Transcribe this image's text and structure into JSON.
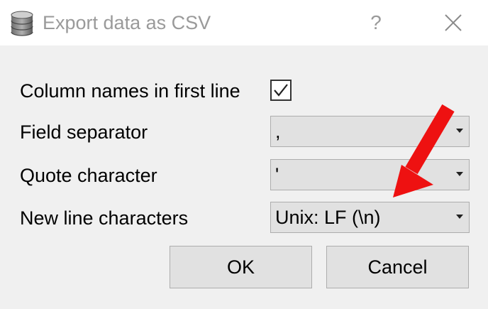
{
  "window": {
    "title": "Export data as CSV",
    "help_label": "?",
    "icon": "database-icon"
  },
  "form": {
    "column_names_label": "Column names in first line",
    "column_names_checked": true,
    "field_separator_label": "Field separator",
    "field_separator_value": ",",
    "quote_character_label": "Quote character",
    "quote_character_value": "'",
    "new_line_label": "New line characters",
    "new_line_value": "Unix: LF (\\n)"
  },
  "buttons": {
    "ok_label": "OK",
    "cancel_label": "Cancel"
  },
  "colors": {
    "annotation_arrow": "#ee1111"
  }
}
